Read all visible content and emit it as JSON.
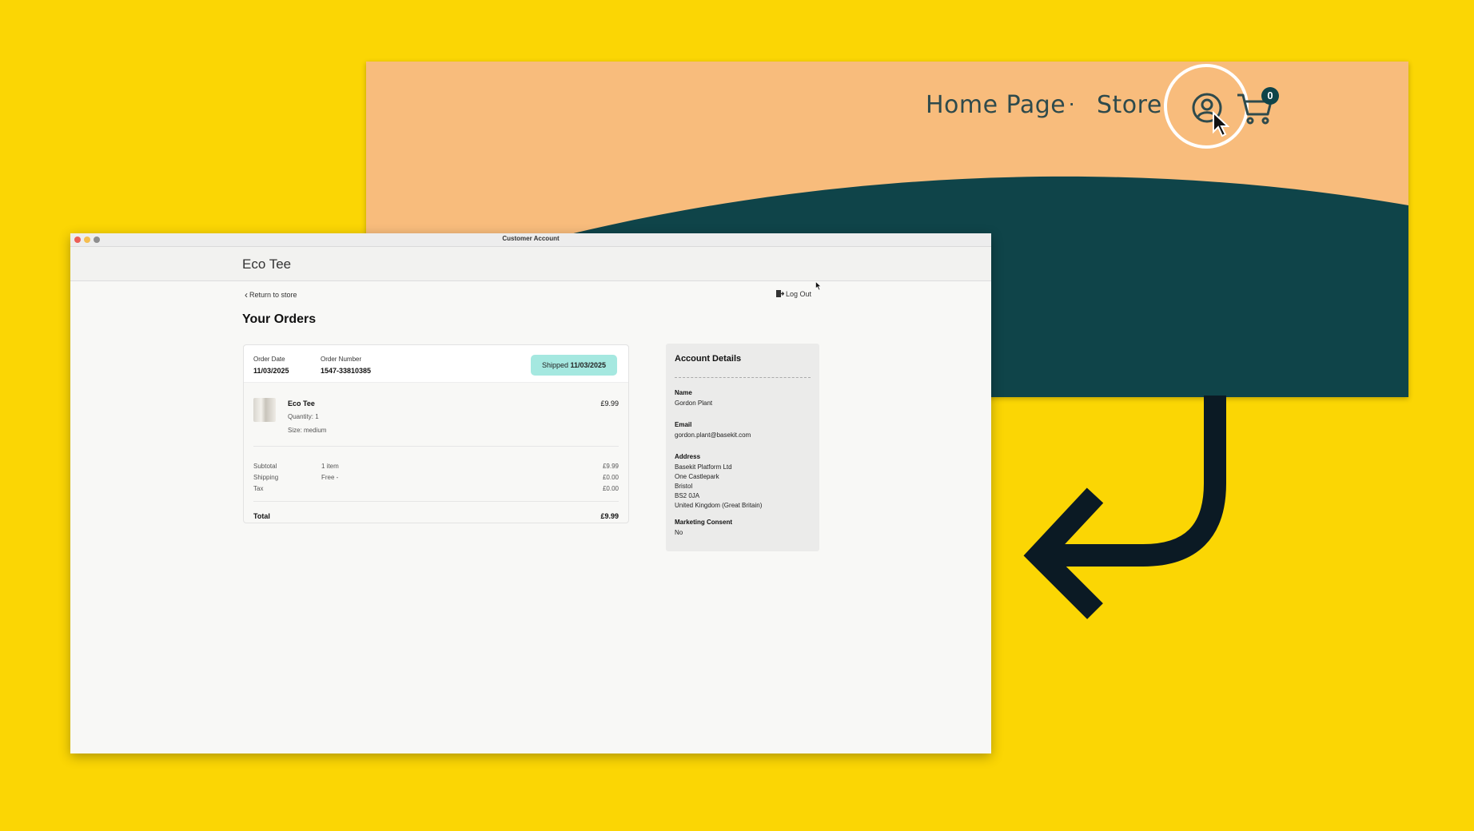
{
  "storefront": {
    "nav": [
      "Home Page",
      "Store"
    ],
    "separator": "·",
    "cart_count": "0",
    "colors": {
      "header": "#F8BC7C",
      "wave": "#0F4449",
      "background": "#FBD604"
    },
    "icons": [
      "account-icon",
      "cart-icon",
      "cursor-icon"
    ]
  },
  "window": {
    "title": "Customer Account"
  },
  "app": {
    "brand": "Eco Tee",
    "return_label": "Return to store",
    "logout_label": "Log Out",
    "heading": "Your Orders"
  },
  "order": {
    "date_label": "Order Date",
    "date": "11/03/2025",
    "number_label": "Order Number",
    "number": "1547-33810385",
    "status": "Shipped",
    "status_date": "11/03/2025",
    "item": {
      "name": "Eco Tee",
      "price": "£9.99",
      "quantity": "Quantity: 1",
      "size": "Size: medium"
    },
    "summary": {
      "subtotal_label": "Subtotal",
      "subtotal_count": "1 item",
      "subtotal": "£9.99",
      "shipping_label": "Shipping",
      "shipping_method": "Free -",
      "shipping": "£0.00",
      "tax_label": "Tax",
      "tax": "£0.00",
      "total_label": "Total",
      "total": "£9.99"
    }
  },
  "account": {
    "title": "Account Details",
    "name_label": "Name",
    "name": "Gordon Plant",
    "email_label": "Email",
    "email": "gordon.plant@basekit.com",
    "address_label": "Address",
    "address": [
      "Basekit Platform Ltd",
      "One Castlepark",
      "Bristol",
      "BS2 0JA",
      "United Kingdom (Great Britain)"
    ],
    "marketing_label": "Marketing Consent",
    "marketing": "No"
  }
}
